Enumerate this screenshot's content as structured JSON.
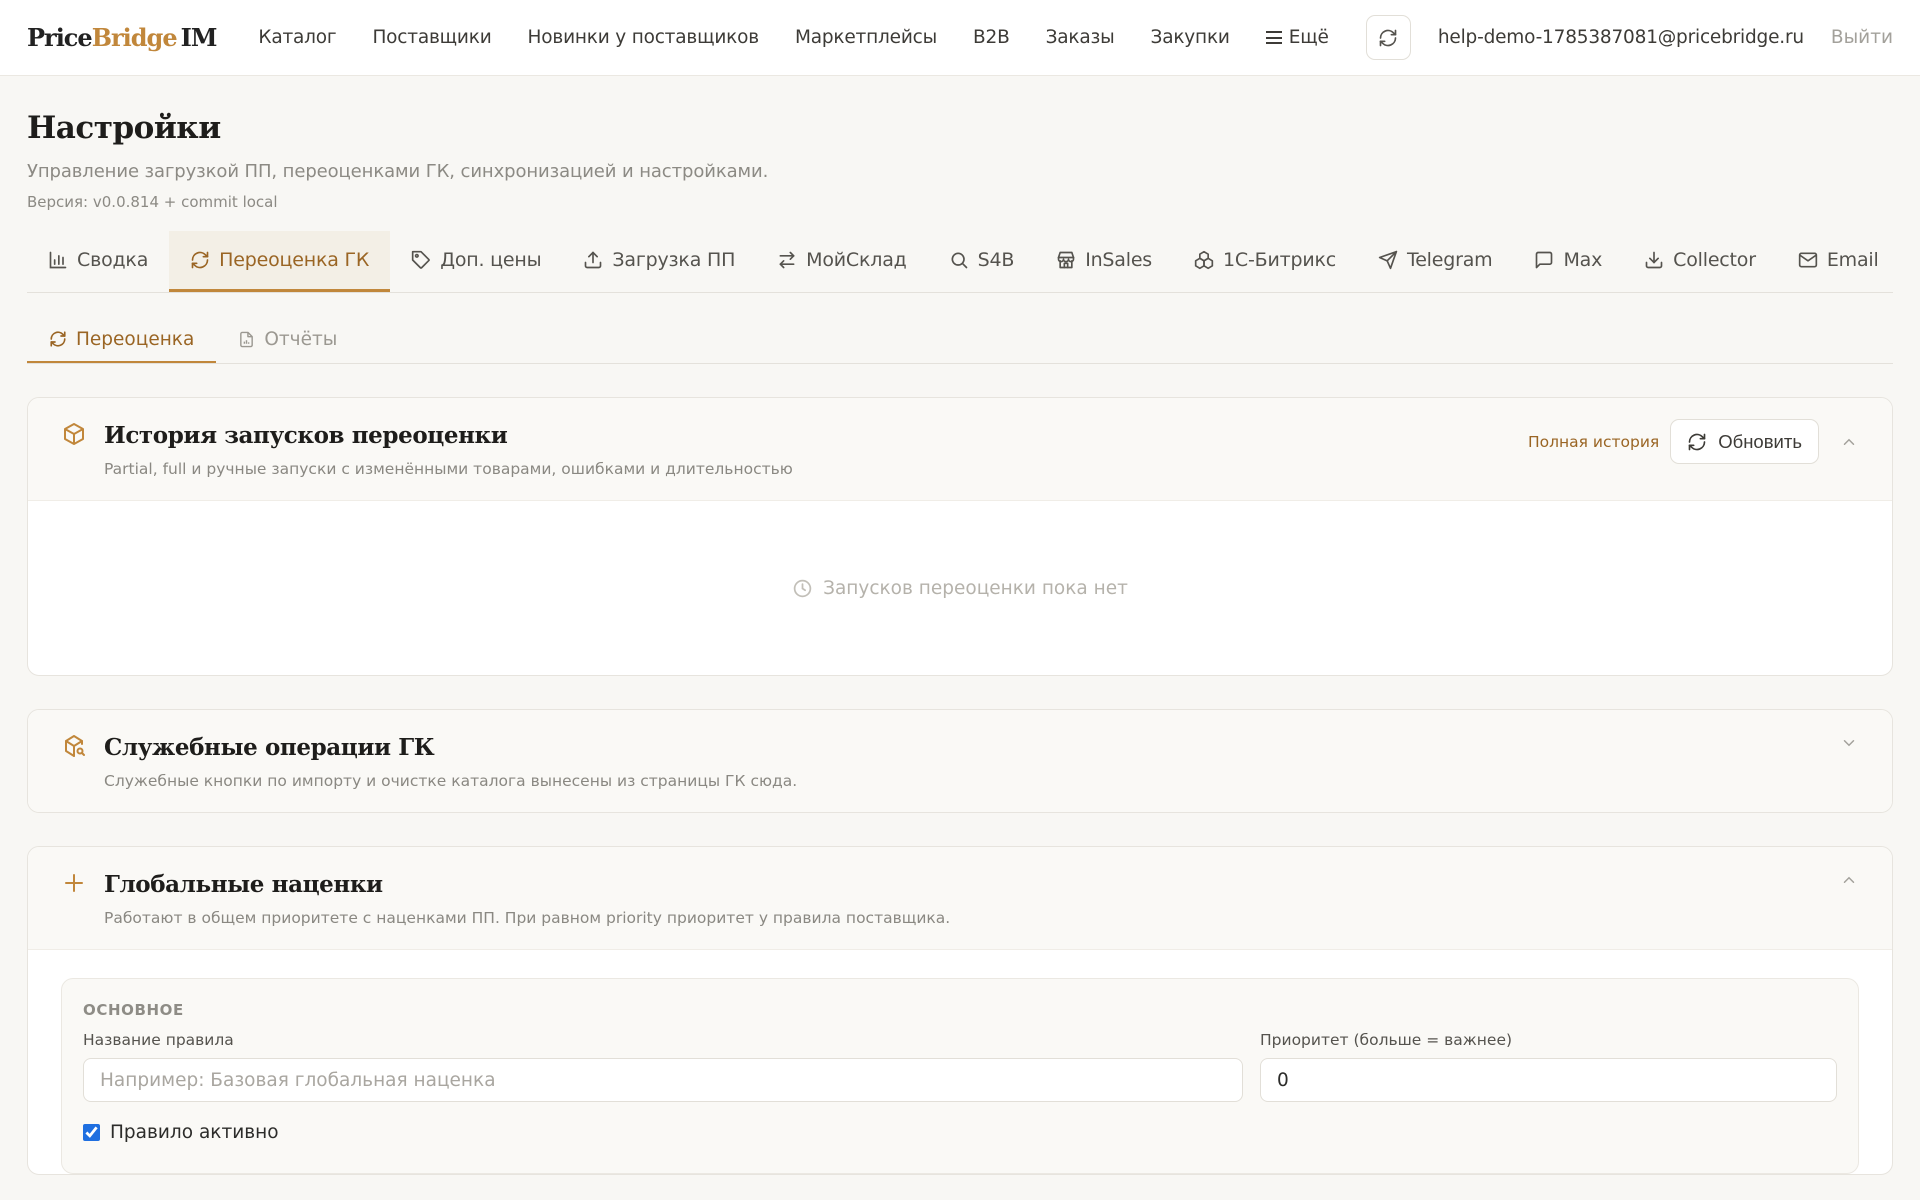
{
  "brand": {
    "part1": "Price",
    "part2": "Bridge",
    "part3": "IM"
  },
  "nav": {
    "items": [
      "Каталог",
      "Поставщики",
      "Новинки у поставщиков",
      "Маркетплейсы",
      "B2B",
      "Заказы",
      "Закупки"
    ],
    "more_label": "Ещё",
    "user_email": "help-demo-1785387081@pricebridge.ru",
    "logout_label": "Выйти"
  },
  "page": {
    "title": "Настройки",
    "subtitle": "Управление загрузкой ПП, переоценками ГК, синхронизацией и настройками.",
    "version": "Версия: v0.0.814 + commit local"
  },
  "tabs": [
    {
      "label": "Сводка",
      "icon": "bar-chart-icon",
      "active": false
    },
    {
      "label": "Переоценка ГК",
      "icon": "refresh-icon",
      "active": true
    },
    {
      "label": "Доп. цены",
      "icon": "tag-icon",
      "active": false
    },
    {
      "label": "Загрузка ПП",
      "icon": "upload-icon",
      "active": false
    },
    {
      "label": "МойСклад",
      "icon": "arrows-swap-icon",
      "active": false
    },
    {
      "label": "S4B",
      "icon": "search-icon",
      "active": false
    },
    {
      "label": "InSales",
      "icon": "store-icon",
      "active": false
    },
    {
      "label": "1С-Битрикс",
      "icon": "boxes-icon",
      "active": false
    },
    {
      "label": "Telegram",
      "icon": "send-icon",
      "active": false
    },
    {
      "label": "Max",
      "icon": "message-icon",
      "active": false
    },
    {
      "label": "Collector",
      "icon": "download-icon",
      "active": false
    },
    {
      "label": "Email",
      "icon": "mail-icon",
      "active": false
    }
  ],
  "subtabs": [
    {
      "label": "Переоценка",
      "icon": "refresh-icon",
      "active": true
    },
    {
      "label": "Отчёты",
      "icon": "report-file-icon",
      "active": false
    }
  ],
  "history_card": {
    "title": "История запусков переоценки",
    "description": "Partial, full и ручные запуски с изменёнными товарами, ошибками и длительностью",
    "full_history_link": "Полная история",
    "refresh_label": "Обновить",
    "empty_text": "Запусков переоценки пока нет"
  },
  "service_card": {
    "title": "Служебные операции ГК",
    "description": "Служебные кнопки по импорту и очистке каталога вынесены из страницы ГК сюда."
  },
  "markups_card": {
    "title": "Глобальные наценки",
    "description": "Работают в общем приоритете с наценками ПП. При равном priority приоритет у правила поставщика.",
    "section_label": "ОСНОВНОЕ",
    "rule_name_label": "Название правила",
    "rule_name_placeholder": "Например: Базовая глобальная наценка",
    "rule_name_value": "",
    "priority_label": "Приоритет (больше = важнее)",
    "priority_value": "0",
    "active_label": "Правило активно",
    "active_checked": true
  },
  "colors": {
    "accent": "#c1873b",
    "accent_text": "#9a6524",
    "active_tab_bg": "#f3efe6"
  }
}
